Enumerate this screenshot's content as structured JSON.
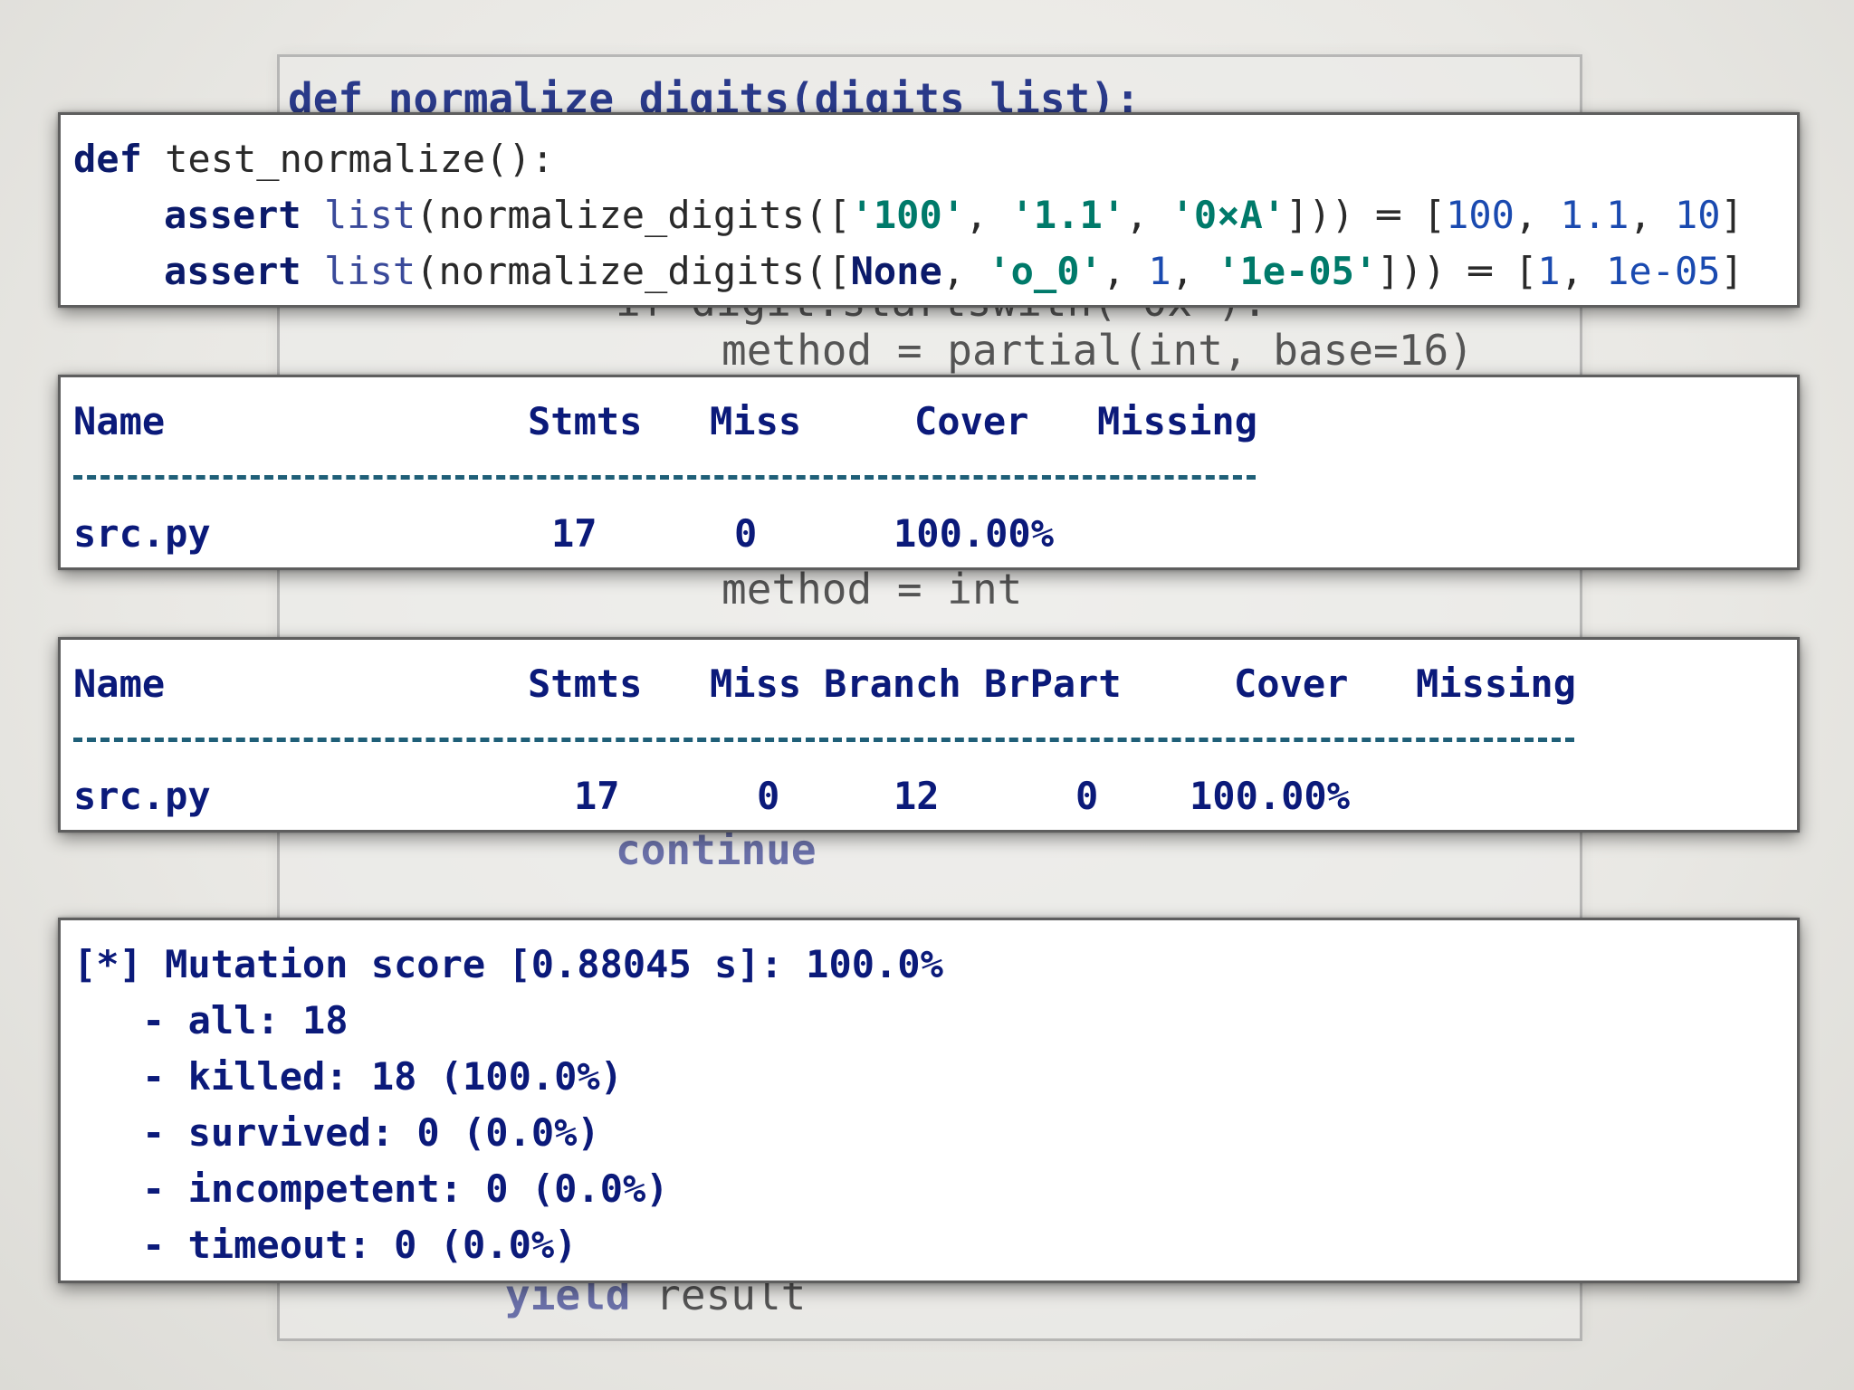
{
  "background_code": {
    "line_def": "def normalize_digits(digits_list):",
    "line_if": "if digit.startswith('0x'):",
    "line_partial": "method = partial(int, base=16)",
    "line_int": "method = int",
    "line_continue": "continue",
    "line_yield_kw": "yield",
    "line_yield_rest": " result"
  },
  "test_box": {
    "line1_kw": "def",
    "line1_rest": " test_normalize():",
    "line2": {
      "assert": "assert",
      "list": "list",
      "call_open": "(normalize_digits([",
      "s1": "'100'",
      "sep1": ", ",
      "s2": "'1.1'",
      "sep2": ", ",
      "s3": "'0×A'",
      "close": "])) ═ [",
      "n1": "100",
      "c1": ", ",
      "n2": "1.1",
      "c2": ", ",
      "n3": "10",
      "end": "]"
    },
    "line3": {
      "assert": "assert",
      "list": "list",
      "call_open": "(normalize_digits([",
      "none": "None",
      "sep1": ", ",
      "s1": "'o_0'",
      "sep2": ", ",
      "n1": "1",
      "sep3": ", ",
      "s2": "'1e-05'",
      "close": "])) ═ [",
      "r1": "1",
      "c1": ", ",
      "r2": "1e-05",
      "end": "]"
    }
  },
  "coverage_table": {
    "headers": [
      "Name",
      "Stmts",
      "Miss",
      "Cover",
      "Missing"
    ],
    "row": {
      "name": "src.py",
      "stmts": "17",
      "miss": "0",
      "cover": "100.00%"
    }
  },
  "branch_table": {
    "headers": [
      "Name",
      "Stmts",
      "Miss",
      "Branch",
      "BrPart",
      "Cover",
      "Missing"
    ],
    "row": {
      "name": "src.py",
      "stmts": "17",
      "miss": "0",
      "branch": "12",
      "brpart": "0",
      "cover": "100.00%"
    }
  },
  "mutation_box": {
    "title": "[*] Mutation score [0.88045 s]: 100.0%",
    "items": [
      "- all: 18",
      "- killed: 18 (100.0%)",
      "- survived: 0 (0.0%)",
      "- incompetent: 0 (0.0%)",
      "- timeout: 0 (0.0%)"
    ]
  },
  "colors": {
    "box_text": "#0b1a7a",
    "string": "#007a6a",
    "number": "#1a4ab0",
    "dash": "#1f5f78"
  }
}
